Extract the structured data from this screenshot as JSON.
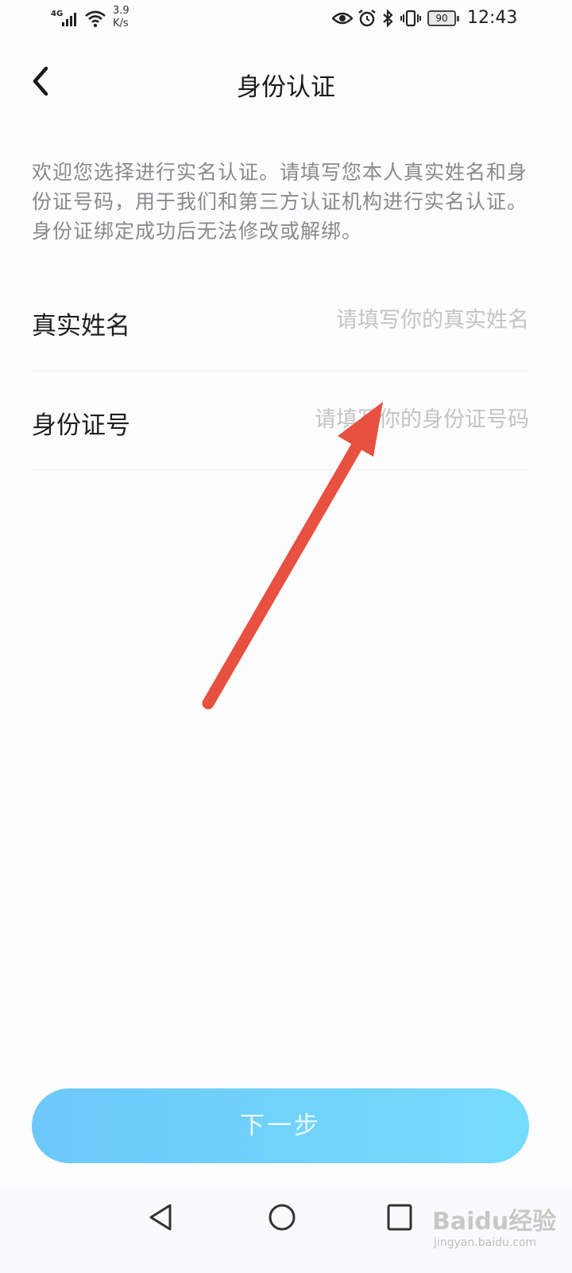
{
  "status_bar": {
    "network_type": "4G",
    "speed_value": "3.9",
    "speed_unit": "K/s",
    "battery": "90",
    "time": "12:43"
  },
  "header": {
    "title": "身份认证"
  },
  "intro": {
    "text": "欢迎您选择进行实名认证。请填写您本人真实姓名和身份证号码，用于我们和第三方认证机构进行实名认证。身份证绑定成功后无法修改或解绑。"
  },
  "form": {
    "name": {
      "label": "真实姓名",
      "value": "",
      "placeholder": "请填写你的真实姓名"
    },
    "id_number": {
      "label": "身份证号",
      "value": "",
      "placeholder": "请填写你的身份证号码"
    }
  },
  "actions": {
    "next_label": "下一步"
  },
  "annotation": {
    "arrow_color": "#e8503f"
  },
  "watermark": {
    "brand": "Baidu经验",
    "url": "jingyan.baidu.com"
  },
  "colors": {
    "button_gradient_start": "#6cc8fa",
    "button_gradient_end": "#76dcfb"
  }
}
